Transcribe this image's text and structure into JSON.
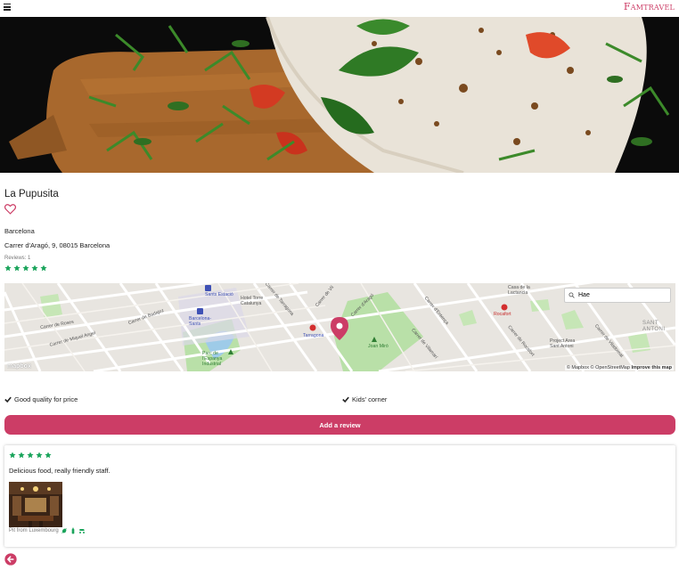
{
  "header": {
    "brand": "Famtravel"
  },
  "place": {
    "name": "La Pupusita",
    "city": "Barcelona",
    "address": "Carrer d'Aragó, 9, 08015 Barcelona",
    "reviews_count": "Reviews: 1",
    "rating": 5
  },
  "map": {
    "search_value": "Hae",
    "attribution": "© Mapbox © OpenStreetMap",
    "improve": "Improve this map",
    "logo": "mapbox",
    "labels": {
      "carrer_roses": "Carrer de Roses",
      "carrer_miquel": "Carrer de Miquel Angel",
      "carrer_badajoz": "Carrer de Badajoz",
      "carrer_tarragona": "Carrer de Tarragona",
      "carrer_vil": "Carrer de Vil",
      "carrer_arago": "Carrer d'Aragó",
      "carrer_entenca": "Carrer d'Entença",
      "carrer_vilamari": "Carrer de Vilamarí",
      "carrer_rocafort": "Carrer de Rocafort",
      "carrer_viladomat": "Carrer de Viladomat",
      "casa_lactancia": "Casa de la Lactancia",
      "sants_estacio": "Sants Estació",
      "barcelona_sants": "Barcelona-Sants",
      "hotel_torre": "Hotel Torre Catalunya",
      "tarragona_metro": "Tarragona",
      "rocafort_metro": "Rocafort",
      "parc_espanya": "Parc de l'Espanya Industrial",
      "joan_miro": "Joan Miró",
      "project_area": "Project Area Sant Antoni",
      "sant_antoni": "SANT ANTONI"
    }
  },
  "features": [
    {
      "label": "Good quality for price"
    },
    {
      "label": "Kids' corner"
    }
  ],
  "actions": {
    "add_review": "Add a review"
  },
  "review": {
    "rating": 5,
    "text": "Delicious food, really friendly staff.",
    "author": "Pit from Luxembourg"
  },
  "colors": {
    "accent": "#cc3d66",
    "star": "#1aa45b",
    "park": "#b9e0a8"
  }
}
